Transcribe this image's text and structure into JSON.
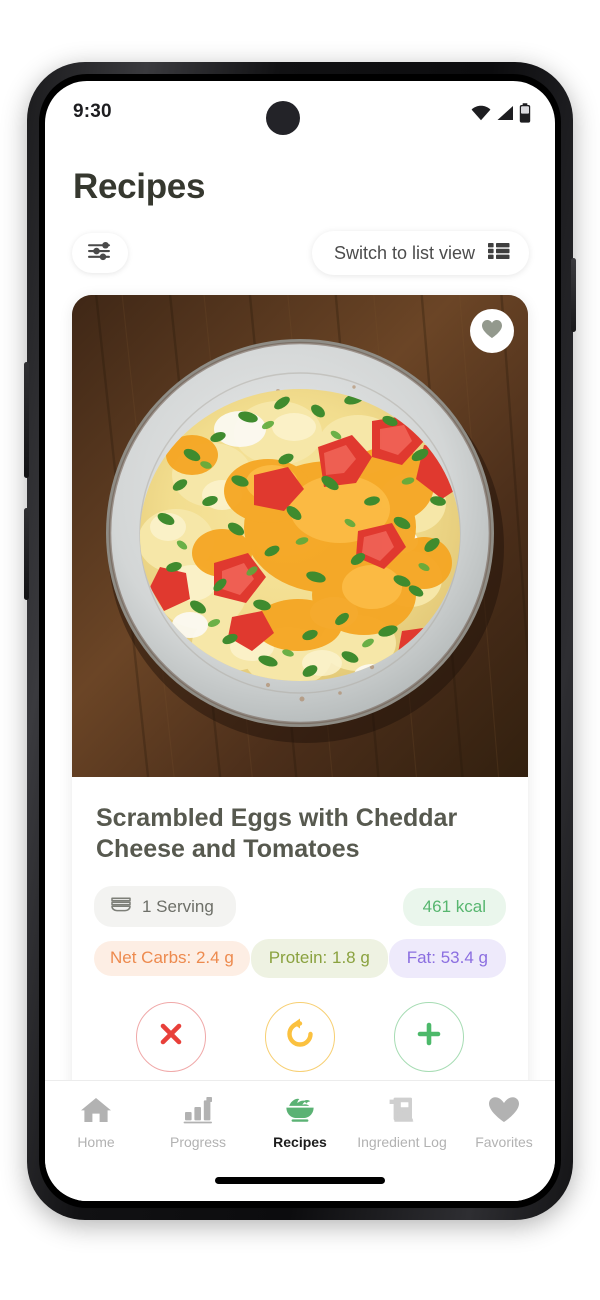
{
  "status_bar": {
    "time": "9:30",
    "icons": [
      "wifi-icon",
      "cellular-signal-icon",
      "battery-icon"
    ]
  },
  "header": {
    "title": "Recipes"
  },
  "toolbar": {
    "filter_button": {
      "icon": "filter-sliders-icon",
      "label": ""
    },
    "list_view_button": {
      "label": "Switch to list view",
      "icon": "list-view-icon"
    }
  },
  "recipe_card": {
    "photo": {
      "alt": "Scrambled eggs with melted cheddar cheese, diced tomatoes and chopped parsley on a speckled gray ceramic plate over a dark wood table",
      "favorite_icon": "heart-icon",
      "favorited": false
    },
    "title": "Scrambled Eggs with Cheddar Cheese and Tomatoes",
    "serving": {
      "icon": "bowl-stack-icon",
      "label": "1 Serving"
    },
    "calories": "461 kcal",
    "macros": [
      {
        "label": "Net Carbs: 2.4 g",
        "color": "#ed8a4e",
        "background": "#fdeee4"
      },
      {
        "label": "Protein: 1.8 g",
        "color": "#8aa23f",
        "background": "#eef2e2"
      },
      {
        "label": "Fat: 53.4 g",
        "color": "#8b6ee0",
        "background": "#eeeafb"
      }
    ],
    "actions": [
      {
        "name": "reject",
        "icon": "close-x-icon",
        "color": "#e8403a"
      },
      {
        "name": "undo",
        "icon": "undo-arrow-icon",
        "color": "#fbc13f"
      },
      {
        "name": "add",
        "icon": "plus-icon",
        "color": "#4cb96a"
      }
    ]
  },
  "bottom_nav": {
    "items": [
      {
        "label": "Home",
        "icon": "home-icon",
        "active": false
      },
      {
        "label": "Progress",
        "icon": "bar-chart-icon",
        "active": false
      },
      {
        "label": "Recipes",
        "icon": "salad-bowl-icon",
        "active": true
      },
      {
        "label": "Ingredient Log",
        "icon": "receipt-basket-icon",
        "active": false
      },
      {
        "label": "Favorites",
        "icon": "heart-icon",
        "active": false
      }
    ]
  },
  "colors": {
    "accent_green": "#57b66f",
    "title_gray": "#57594f",
    "inactive_gray": "#b2b2b2"
  }
}
